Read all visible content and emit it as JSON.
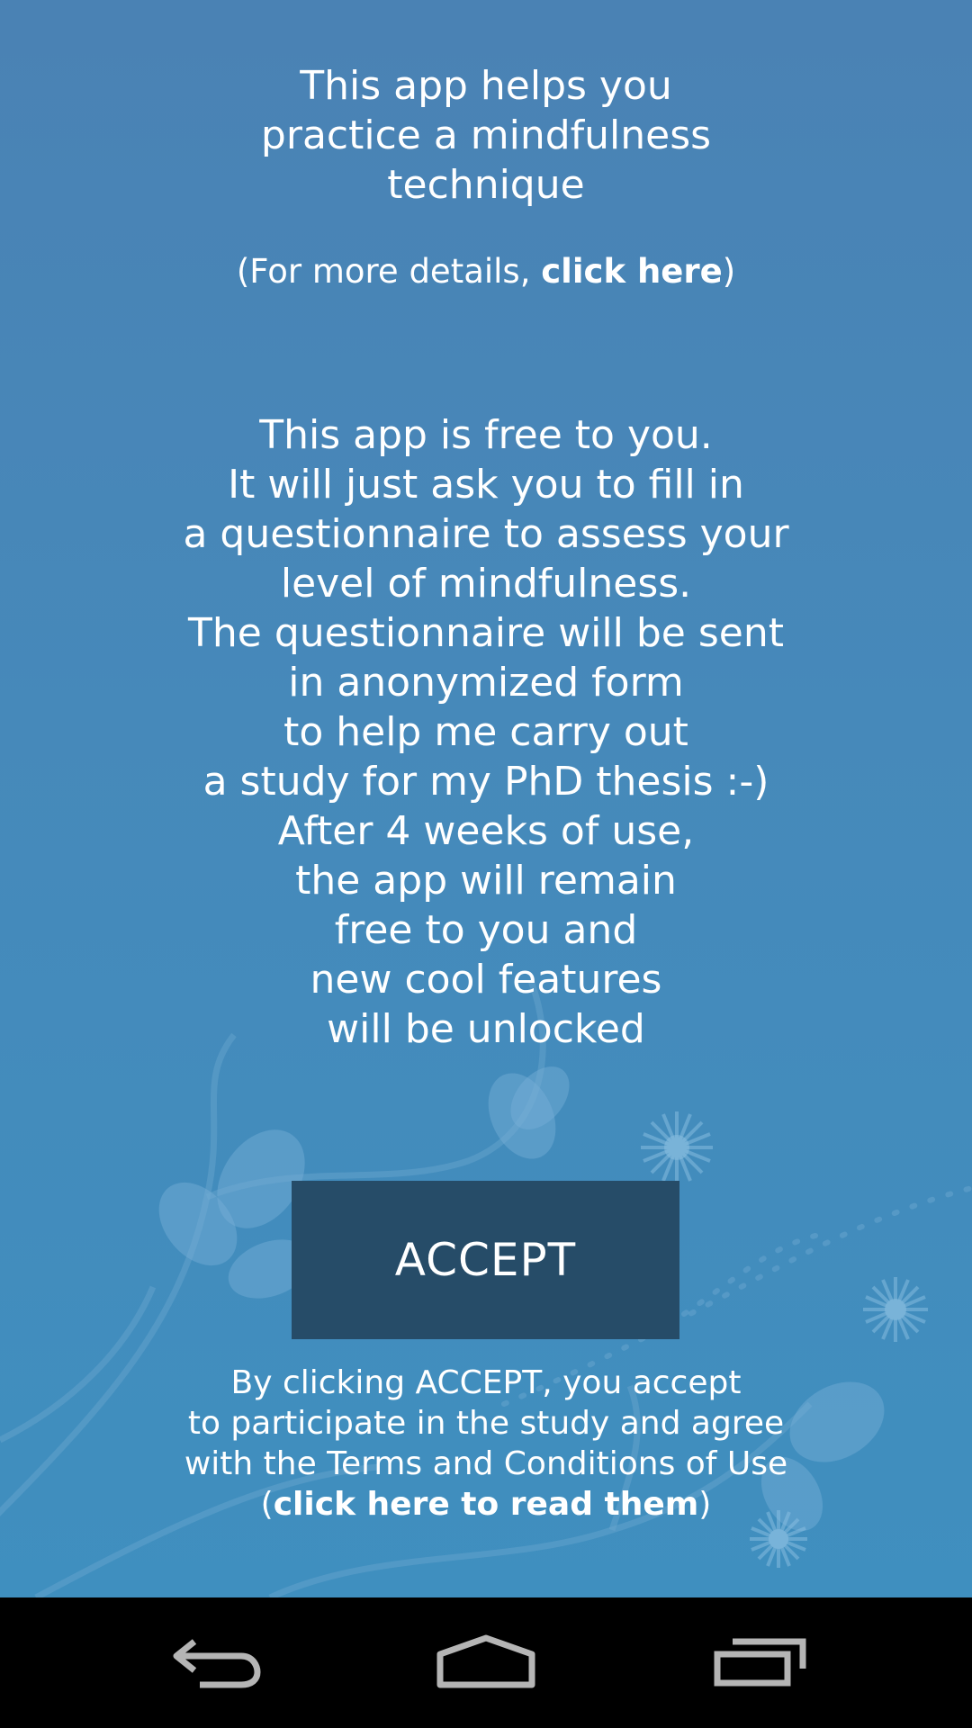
{
  "intro": {
    "lines": [
      "This app helps you",
      "practice a mindfulness",
      "technique"
    ]
  },
  "details": {
    "prefix": "(For more details, ",
    "link_label": "click here",
    "suffix": ")"
  },
  "info": {
    "lines": [
      "This app is free to you.",
      "It will just ask you to fill in",
      "a questionnaire to assess your",
      "level of mindfulness.",
      "The questionnaire will be sent",
      "in anonymized form",
      "to help me carry out",
      "a study for my PhD thesis :-)",
      "After 4 weeks of use,",
      "the app will remain",
      "free to you and",
      "new cool features",
      "will be unlocked"
    ]
  },
  "accept_button": {
    "label": "ACCEPT"
  },
  "consent": {
    "lines": [
      "By clicking ACCEPT, you accept",
      "to participate in the study and agree",
      "with the Terms and Conditions of Use"
    ],
    "link_prefix": "(",
    "link_label": "click here to read them",
    "link_suffix": ")"
  },
  "navigation_bar": {
    "buttons": [
      "back-icon",
      "home-icon",
      "recent-apps-icon"
    ]
  },
  "colors": {
    "background_top": "#4a82b4",
    "background_bottom": "#3f8fbf",
    "button": "#264c68",
    "text": "#ffffff",
    "navbar": "#000000"
  }
}
